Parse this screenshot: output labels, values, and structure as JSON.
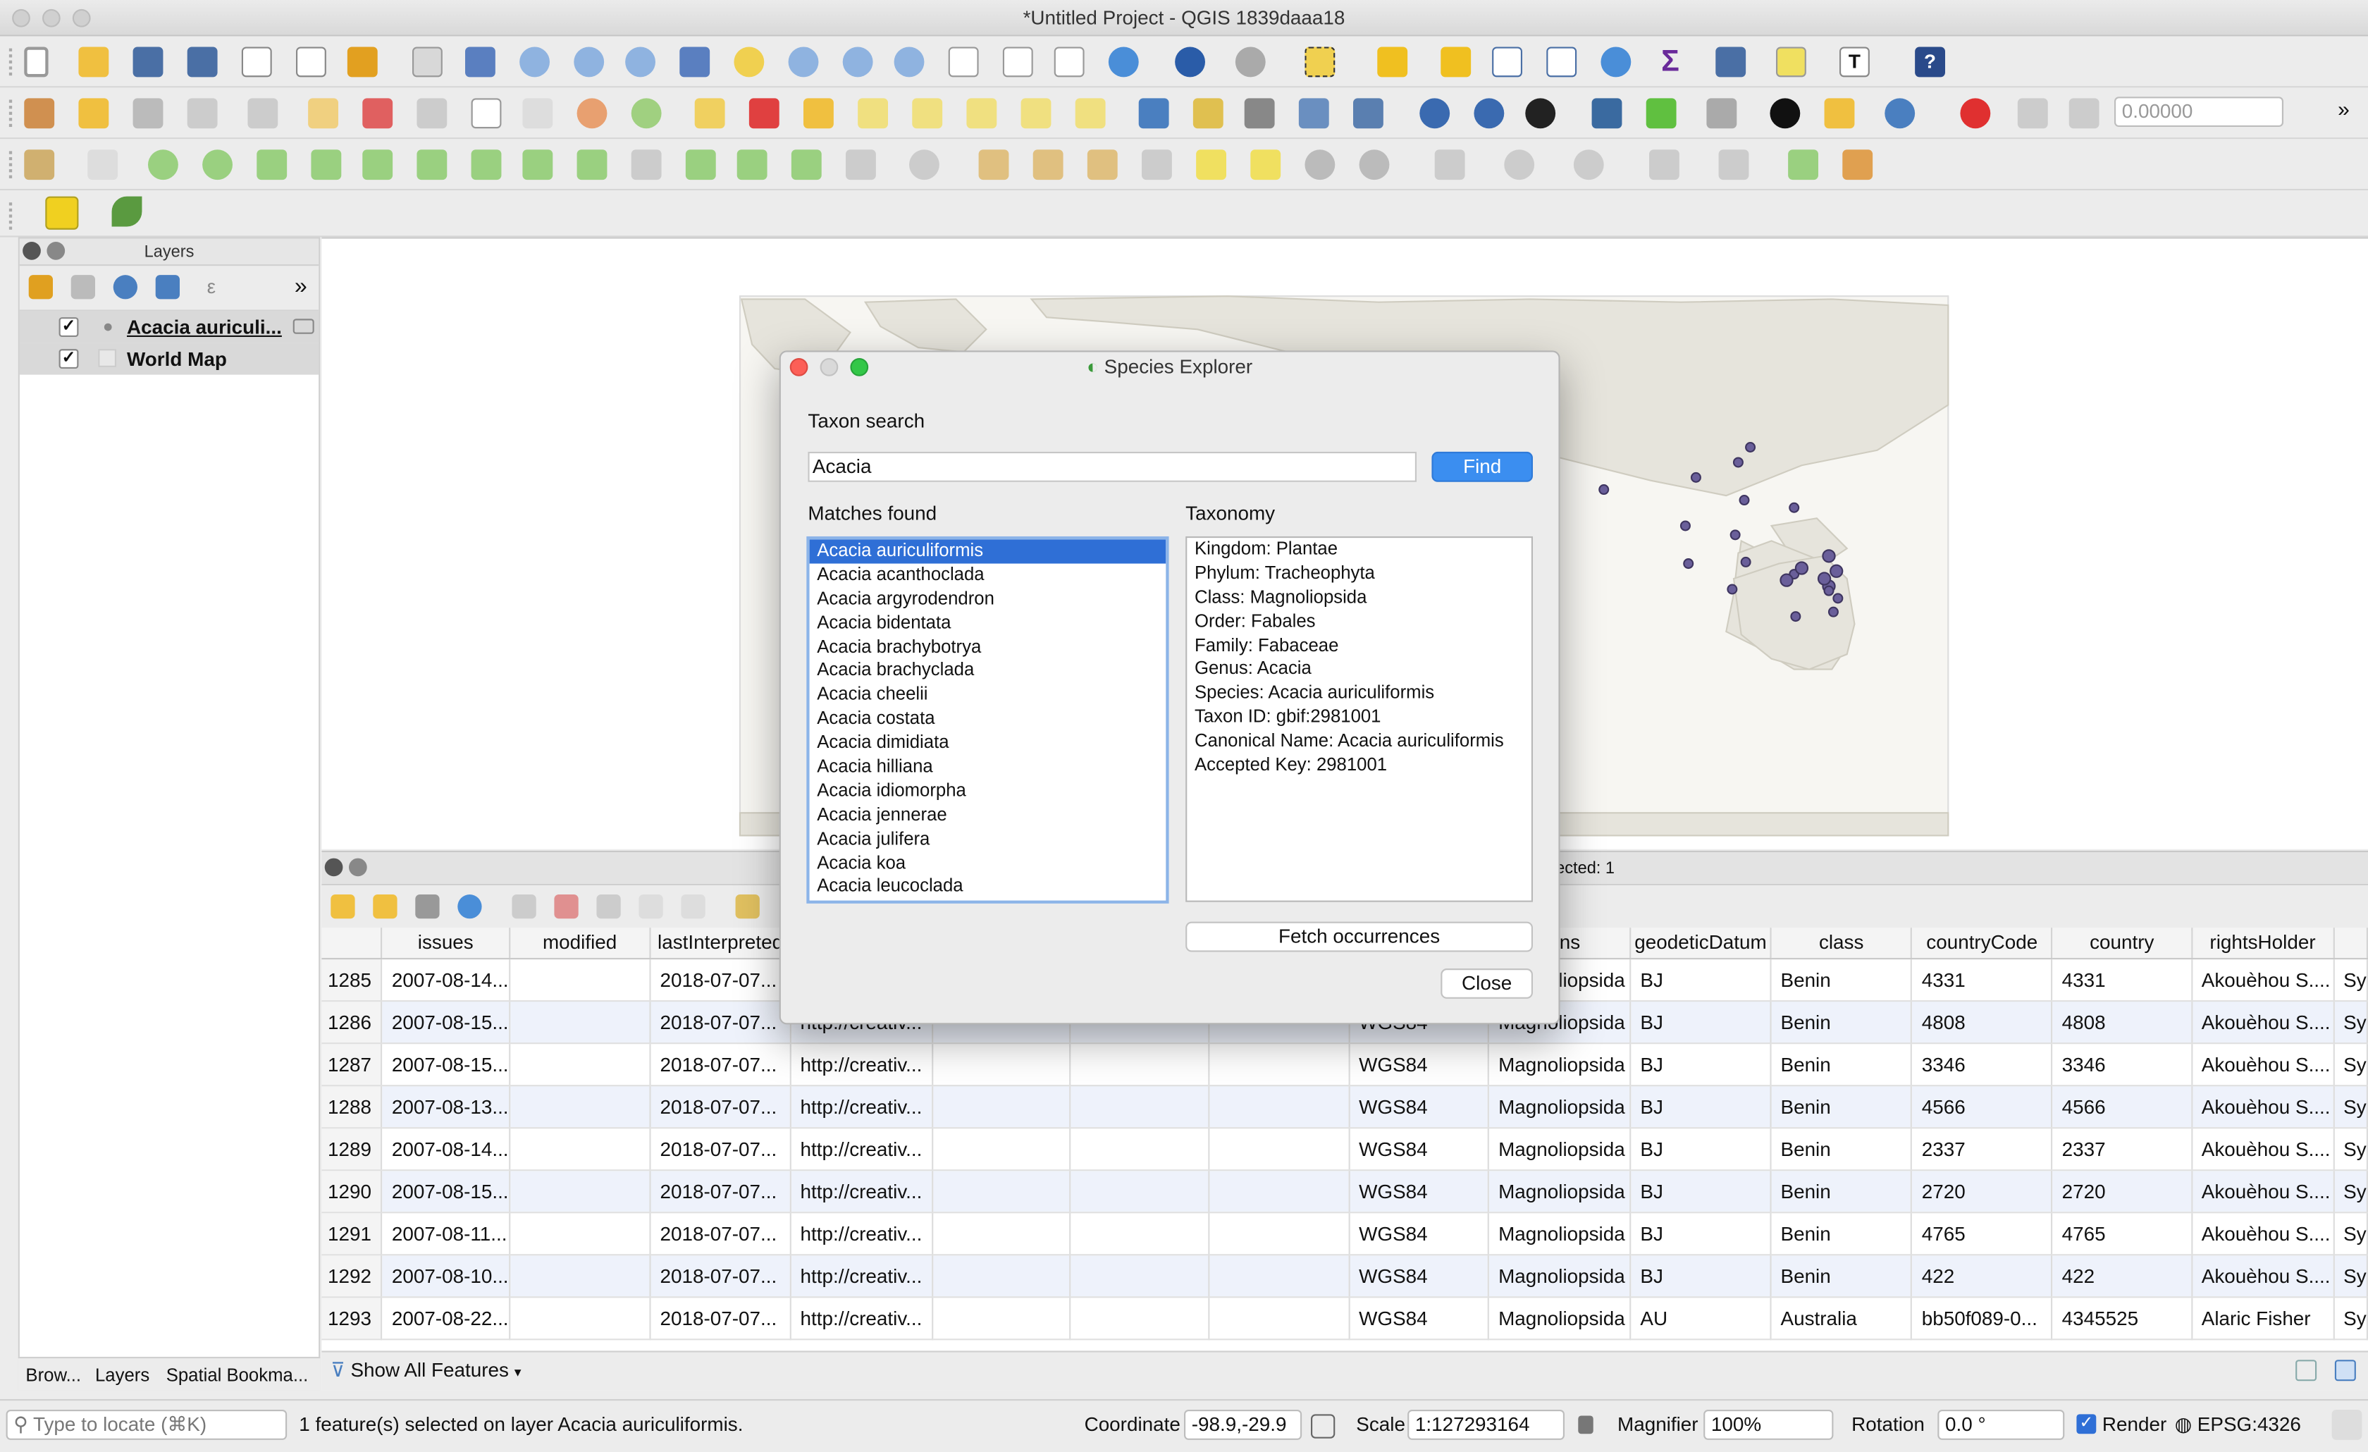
{
  "window": {
    "title": "*Untitled Project - QGIS 1839daaa18"
  },
  "toolbar": {
    "rotation_value": "0.00000"
  },
  "layers_panel": {
    "title": "Layers",
    "layers": [
      {
        "name": "Acacia auriculi...",
        "checked": "✓"
      },
      {
        "name": "World Map",
        "checked": "✓"
      }
    ],
    "bottom_tabs": [
      "Brow...",
      "Layers",
      "Spatial Bookma..."
    ]
  },
  "attribute_table": {
    "selected_status": "ected: 1",
    "columns": [
      "",
      "issues",
      "modified",
      "lastInterpreted",
      "",
      "",
      "",
      "",
      "",
      "tions",
      "geodeticDatum",
      "class",
      "countryCode",
      "country",
      "rightsHolder",
      ""
    ],
    "rows": [
      [
        "1285",
        "2007-08-14...",
        "",
        "2018-07-07...",
        "",
        "",
        "",
        "",
        "",
        "Magnoliopsida",
        "BJ",
        "Benin",
        "4331",
        "4331",
        "Akouèhou S....",
        "Sy"
      ],
      [
        "1286",
        "2007-08-15...",
        "",
        "2018-07-07...",
        "http://creativ...",
        "",
        "",
        "",
        "WGS84",
        "Magnoliopsida",
        "BJ",
        "Benin",
        "4808",
        "4808",
        "Akouèhou S....",
        "Sy"
      ],
      [
        "1287",
        "2007-08-15...",
        "",
        "2018-07-07...",
        "http://creativ...",
        "",
        "",
        "",
        "WGS84",
        "Magnoliopsida",
        "BJ",
        "Benin",
        "3346",
        "3346",
        "Akouèhou S....",
        "Sy"
      ],
      [
        "1288",
        "2007-08-13...",
        "",
        "2018-07-07...",
        "http://creativ...",
        "",
        "",
        "",
        "WGS84",
        "Magnoliopsida",
        "BJ",
        "Benin",
        "4566",
        "4566",
        "Akouèhou S....",
        "Sy"
      ],
      [
        "1289",
        "2007-08-14...",
        "",
        "2018-07-07...",
        "http://creativ...",
        "",
        "",
        "",
        "WGS84",
        "Magnoliopsida",
        "BJ",
        "Benin",
        "2337",
        "2337",
        "Akouèhou S....",
        "Sy"
      ],
      [
        "1290",
        "2007-08-15...",
        "",
        "2018-07-07...",
        "http://creativ...",
        "",
        "",
        "",
        "WGS84",
        "Magnoliopsida",
        "BJ",
        "Benin",
        "2720",
        "2720",
        "Akouèhou S....",
        "Sy"
      ],
      [
        "1291",
        "2007-08-11...",
        "",
        "2018-07-07...",
        "http://creativ...",
        "",
        "",
        "",
        "WGS84",
        "Magnoliopsida",
        "BJ",
        "Benin",
        "4765",
        "4765",
        "Akouèhou S....",
        "Sy"
      ],
      [
        "1292",
        "2007-08-10...",
        "",
        "2018-07-07...",
        "http://creativ...",
        "",
        "",
        "",
        "WGS84",
        "Magnoliopsida",
        "BJ",
        "Benin",
        "422",
        "422",
        "Akouèhou S....",
        "Sy"
      ],
      [
        "1293",
        "2007-08-22...",
        "",
        "2018-07-07...",
        "http://creativ...",
        "",
        "",
        "",
        "WGS84",
        "Magnoliopsida",
        "AU",
        "Australia",
        "bb50f089-0...",
        "4345525",
        "Alaric Fisher",
        "Sy"
      ]
    ],
    "show_all_label": "Show All Features"
  },
  "dialog": {
    "title": "Species Explorer",
    "taxon_search_label": "Taxon search",
    "search_value": "Acacia",
    "find_label": "Find",
    "matches_label": "Matches found",
    "taxonomy_label": "Taxonomy",
    "matches": [
      "Acacia auriculiformis",
      "Acacia acanthoclada",
      "Acacia argyrodendron",
      "Acacia bidentata",
      "Acacia brachybotrya",
      "Acacia brachyclada",
      "Acacia cheelii",
      "Acacia costata",
      "Acacia dimidiata",
      "Acacia hilliana",
      "Acacia idiomorpha",
      "Acacia jennerae",
      "Acacia julifera",
      "Acacia koa",
      "Acacia leucoclada"
    ],
    "taxonomy": [
      "Kingdom: Plantae",
      "Phylum: Tracheophyta",
      "Class: Magnoliopsida",
      "Order: Fabales",
      "Family: Fabaceae",
      "Genus: Acacia",
      "Species: Acacia auriculiformis",
      "Taxon ID: gbif:2981001",
      "Canonical Name: Acacia auriculiformis",
      "Accepted Key: 2981001"
    ],
    "fetch_label": "Fetch occurrences",
    "close_label": "Close"
  },
  "statusbar": {
    "locate_placeholder": "Type to locate (⌘K)",
    "message": "1 feature(s) selected on layer Acacia auriculiformis.",
    "coordinate_label": "Coordinate",
    "coordinate_value": "-98.9,-29.9",
    "scale_label": "Scale",
    "scale_value": "1:127293164",
    "magnifier_label": "Magnifier",
    "magnifier_value": "100%",
    "rotation_label": "Rotation",
    "rotation_value": "0.0 °",
    "render_label": "Render",
    "crs": "EPSG:4326"
  },
  "colors": {
    "selection": "#2f6fd6",
    "find_button": "#3b8ef0",
    "point": "#5b4f85"
  }
}
